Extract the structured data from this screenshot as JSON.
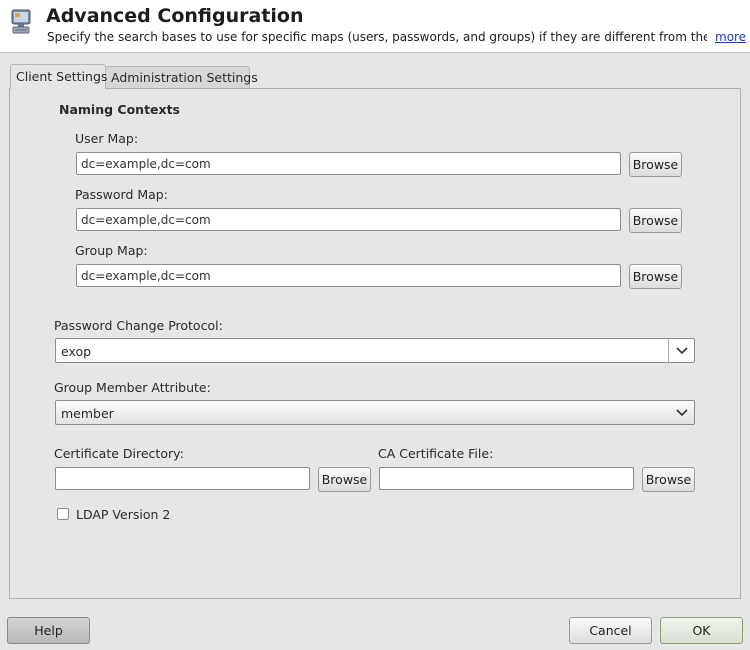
{
  "header": {
    "title": "Advanced Configuration",
    "subtitle": "Specify the search bases to use for specific maps (users, passwords, and groups) if they are different from the b...",
    "more_link": "more",
    "icon": "ldap-client-icon"
  },
  "tabs": [
    {
      "label": "Client Settings",
      "active": true
    },
    {
      "label": "Administration Settings",
      "active": false
    }
  ],
  "naming_contexts": {
    "title": "Naming Contexts",
    "user_map": {
      "label": "User Map:",
      "value": "dc=example,dc=com",
      "button": "Browse"
    },
    "password_map": {
      "label": "Password Map:",
      "value": "dc=example,dc=com",
      "button": "Browse"
    },
    "group_map": {
      "label": "Group Map:",
      "value": "dc=example,dc=com",
      "button": "Browse"
    }
  },
  "password_change_protocol": {
    "label": "Password Change Protocol:",
    "value": "exop"
  },
  "group_member_attribute": {
    "label": "Group Member Attribute:",
    "value": "member"
  },
  "certificate_directory": {
    "label": "Certificate Directory:",
    "value": "",
    "button": "Browse"
  },
  "ca_certificate_file": {
    "label": "CA Certificate File:",
    "value": "",
    "button": "Browse"
  },
  "ldap_version_2": {
    "label": "LDAP Version 2",
    "checked": false
  },
  "footer": {
    "help": "Help",
    "cancel": "Cancel",
    "ok": "OK"
  }
}
